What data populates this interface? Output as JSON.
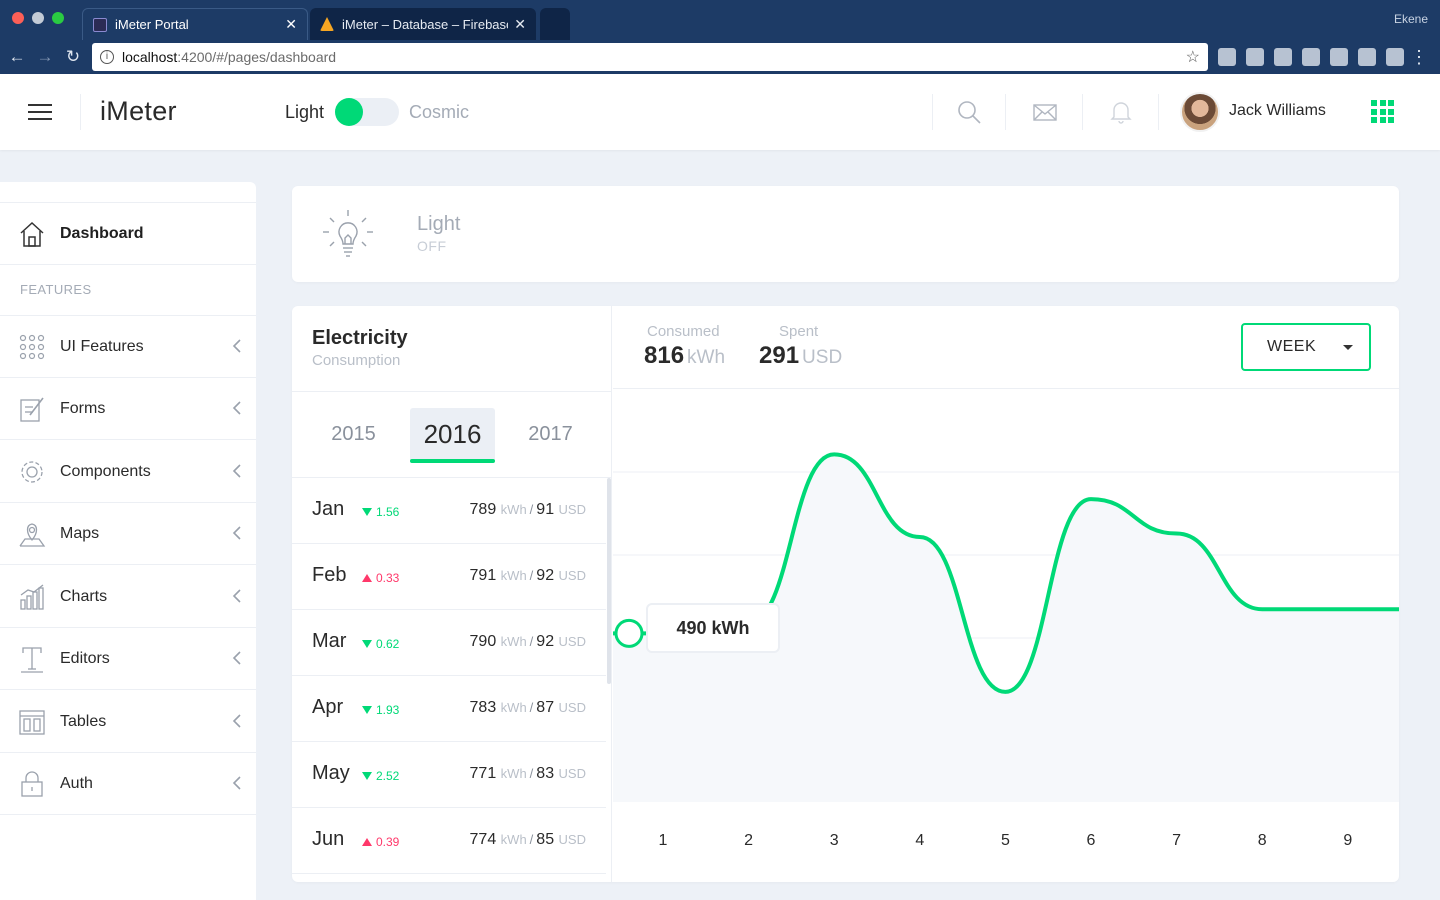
{
  "browser": {
    "tabs": [
      {
        "title": "iMeter Portal",
        "active": true
      },
      {
        "title": "iMeter – Database – Firebase c",
        "active": false
      }
    ],
    "profile": "Ekene",
    "url_host": "localhost",
    "url_path": ":4200/#/pages/dashboard"
  },
  "header": {
    "brand": "iMeter",
    "theme_light": "Light",
    "theme_cosmic": "Cosmic",
    "user_name": "Jack Williams"
  },
  "sidebar": {
    "dashboard": "Dashboard",
    "section_label": "FEATURES",
    "items": [
      {
        "label": "UI Features",
        "icon": "grid-dots-icon"
      },
      {
        "label": "Forms",
        "icon": "edit-icon"
      },
      {
        "label": "Components",
        "icon": "gear-icon"
      },
      {
        "label": "Maps",
        "icon": "map-pin-icon"
      },
      {
        "label": "Charts",
        "icon": "bar-chart-icon"
      },
      {
        "label": "Editors",
        "icon": "text-icon"
      },
      {
        "label": "Tables",
        "icon": "table-icon"
      },
      {
        "label": "Auth",
        "icon": "lock-icon"
      }
    ]
  },
  "light_card": {
    "title": "Light",
    "status": "OFF"
  },
  "electricity": {
    "title": "Electricity",
    "subtitle": "Consumption",
    "years": [
      "2015",
      "2016",
      "2017"
    ],
    "selected_year": "2016",
    "months": [
      {
        "name": "Jan",
        "delta": "1.56",
        "direction": "down",
        "kwh": "789",
        "usd": "91"
      },
      {
        "name": "Feb",
        "delta": "0.33",
        "direction": "up",
        "kwh": "791",
        "usd": "92"
      },
      {
        "name": "Mar",
        "delta": "0.62",
        "direction": "down",
        "kwh": "790",
        "usd": "92"
      },
      {
        "name": "Apr",
        "delta": "1.93",
        "direction": "down",
        "kwh": "783",
        "usd": "87"
      },
      {
        "name": "May",
        "delta": "2.52",
        "direction": "down",
        "kwh": "771",
        "usd": "83"
      },
      {
        "name": "Jun",
        "delta": "0.39",
        "direction": "up",
        "kwh": "774",
        "usd": "85"
      }
    ],
    "unit_kwh": "kWh",
    "unit_usd": "USD",
    "consumed_label": "Consumed",
    "consumed_value": "816",
    "consumed_unit": "kWh",
    "spent_label": "Spent",
    "spent_value": "291",
    "spent_unit": "USD",
    "period": "WEEK",
    "tooltip": "490 kWh"
  },
  "chart_data": {
    "type": "area",
    "categories": [
      "1",
      "2",
      "3",
      "4",
      "5",
      "6",
      "7",
      "8",
      "9"
    ],
    "series": [
      {
        "values": [
          490,
          520,
          1010,
          770,
          320,
          880,
          780,
          560,
          560
        ]
      }
    ],
    "highlight": {
      "x": "1",
      "value": 490,
      "label": "490 kWh"
    },
    "grid": true,
    "color": "#00d977"
  },
  "colors": {
    "accent": "#00d977",
    "danger": "#ff386a",
    "background": "#edf1f7"
  }
}
